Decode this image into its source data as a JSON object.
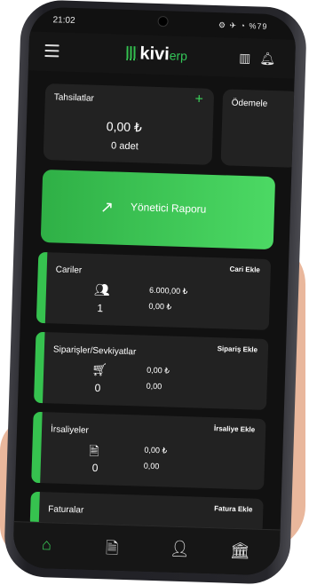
{
  "status_bar": {
    "time": "21:02",
    "icons_text": "⚙ ✈ ◔ %79"
  },
  "header": {
    "app_logo_main": "kivi",
    "app_logo_suffix": "erp"
  },
  "cards": {
    "tahsilatlar": {
      "title": "Tahsilatlar",
      "amount": "0,00 ₺",
      "count": "0 adet",
      "add_symbol": "+"
    },
    "odemeler": {
      "title": "Ödemele"
    }
  },
  "report_button": {
    "label": "Yönetici Raporu"
  },
  "sections": {
    "cariler": {
      "title": "Cariler",
      "add_label": "Cari Ekle",
      "count": "1",
      "value_1": "6.000,00 ₺",
      "value_2": "0,00 ₺"
    },
    "siparisler": {
      "title": "Siparişler/Sevkiyatlar",
      "add_label": "Sipariş Ekle",
      "count": "0",
      "value_1": "0,00 ₺",
      "value_2": "0,00"
    },
    "irsaliyeler": {
      "title": "İrsaliyeler",
      "add_label": "İrsaliye Ekle",
      "count": "0",
      "value_1": "0,00 ₺",
      "value_2": "0,00"
    },
    "faturalar": {
      "title": "Faturalar",
      "add_label": "Fatura Ekle"
    }
  },
  "colors": {
    "accent": "#36c24f",
    "panel": "#222222",
    "background": "#111111"
  },
  "icons": [
    "menu-icon",
    "barcode-icon",
    "bell-icon",
    "trend-up-icon",
    "home-icon",
    "document-icon",
    "user-icon",
    "bank-icon"
  ]
}
